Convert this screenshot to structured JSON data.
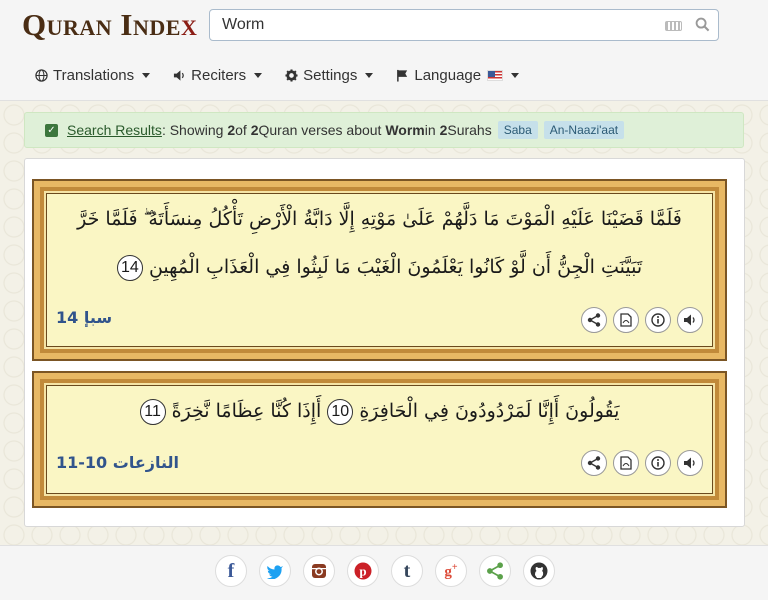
{
  "logo": {
    "text_main": "Quran Inde",
    "text_x": "x"
  },
  "search": {
    "value": "Worm"
  },
  "menu": [
    {
      "label": "Translations",
      "icon": "globe-icon"
    },
    {
      "label": "Reciters",
      "icon": "speaker-icon"
    },
    {
      "label": "Settings",
      "icon": "gear-icon"
    },
    {
      "label": "Language",
      "icon": "flag-icon"
    }
  ],
  "alert": {
    "link": "Search Results",
    "t1": ": Showing ",
    "count": "2",
    "t2": " of ",
    "total": "2",
    "t3": " Quran verses about ",
    "query": "Worm",
    "t4": " in ",
    "surah_count": "2",
    "t5": " Surahs",
    "tags": [
      "Saba",
      "An-Naazi'aat"
    ]
  },
  "verses": [
    {
      "line1": "فَلَمَّا قَضَيْنَا عَلَيْهِ الْمَوْتَ مَا دَلَّهُمْ عَلَىٰ مَوْتِهِ إِلَّا دَابَّةُ الْأَرْضِ تَأْكُلُ مِنسَأَتَهُ ۖ فَلَمَّا خَرَّ",
      "line2": "تَبَيَّنَتِ الْجِنُّ أَن لَّوْ كَانُوا يَعْلَمُونَ الْغَيْبَ مَا لَبِثُوا فِي الْعَذَابِ الْمُهِينِ",
      "num": "14",
      "ref": "سبإ 14"
    },
    {
      "line1a": "يَقُولُونَ أَإِنَّا لَمَرْدُودُونَ فِي الْحَافِرَةِ",
      "num_a": "10",
      "line1b": "أَإِذَا كُنَّا عِظَامًا نَّخِرَةً",
      "num_b": "11",
      "ref": "النازعات 10-11"
    }
  ],
  "verse_buttons": [
    "share-icon",
    "pdf-icon",
    "info-icon",
    "audio-icon"
  ],
  "social": [
    "facebook-icon",
    "twitter-icon",
    "instagram-icon",
    "pinterest-icon",
    "tumblr-icon",
    "google-plus-icon",
    "share-icon",
    "github-icon"
  ],
  "colors": {
    "brand": "#4a2d14",
    "accent": "#8b1d15",
    "verse_bg": "#faf6c4",
    "ref": "#31548c",
    "alert_bg": "#dff0d8"
  }
}
